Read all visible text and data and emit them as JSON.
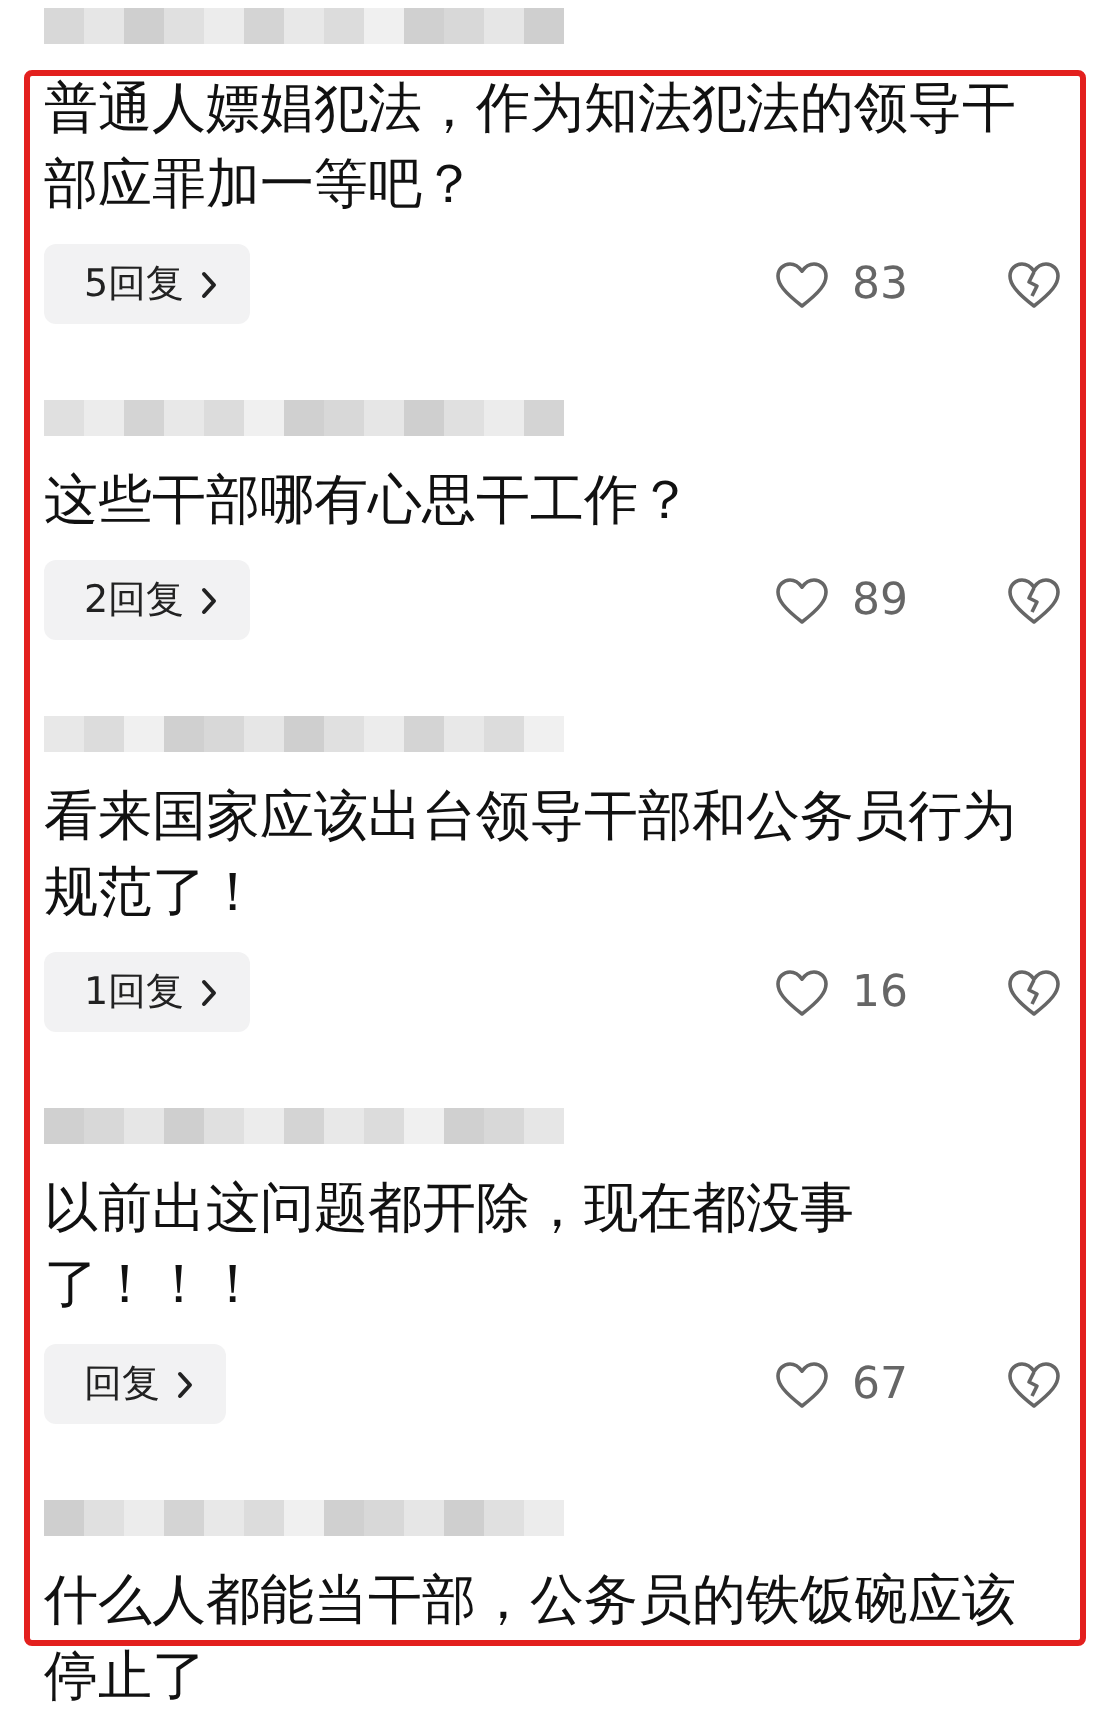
{
  "comments": [
    {
      "text": "普通人嫖娼犯法，作为知法犯法的领导干部应罪加一等吧？",
      "replies": "5回复",
      "likes": "83"
    },
    {
      "text": "这些干部哪有心思干工作？",
      "replies": "2回复",
      "likes": "89"
    },
    {
      "text": "看来国家应该出台领导干部和公务员行为规范了！",
      "replies": "1回复",
      "likes": "16"
    },
    {
      "text": "以前出这问题都开除，现在都没事了！！！",
      "replies": "回复",
      "likes": "67"
    },
    {
      "text": "什么人都能当干部，公务员的铁饭碗应该停止了"
    }
  ]
}
